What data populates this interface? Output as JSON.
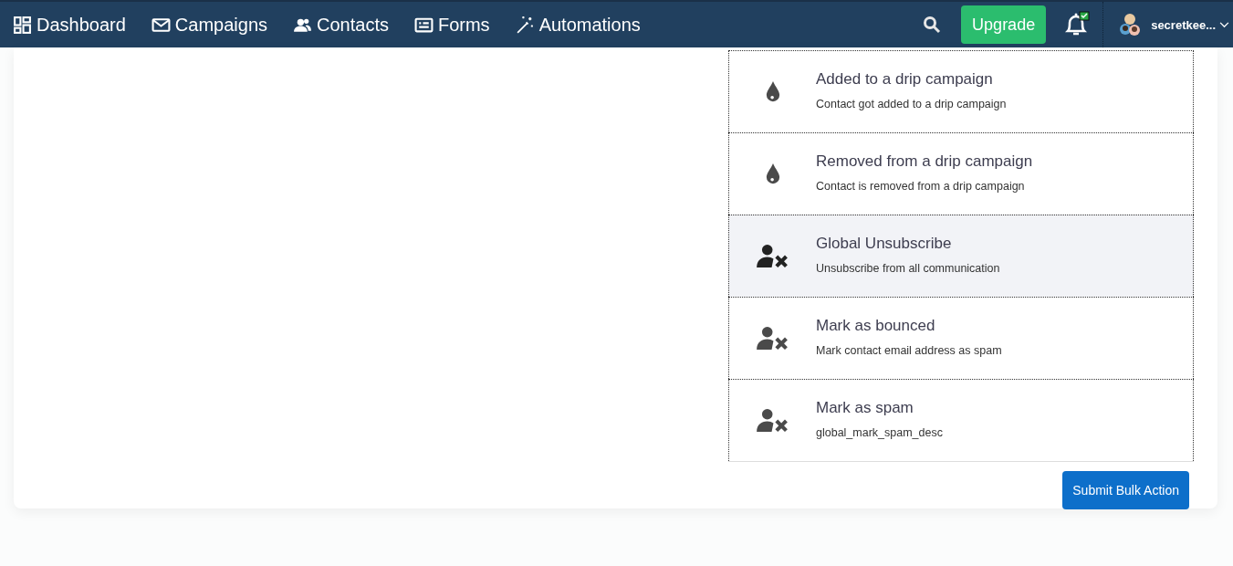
{
  "nav": {
    "items": [
      {
        "label": "Dashboard",
        "kind": "dashboard"
      },
      {
        "label": "Campaigns",
        "kind": "mail"
      },
      {
        "label": "Contacts",
        "kind": "people"
      },
      {
        "label": "Forms",
        "kind": "form"
      },
      {
        "label": "Automations",
        "kind": "wand"
      }
    ],
    "upgrade": "Upgrade",
    "user": "secretkee..."
  },
  "actions": [
    {
      "title": "Added to a drip campaign",
      "description": "Contact got added to a drip campaign",
      "kind": "drip",
      "selected": false
    },
    {
      "title": "Removed from a drip campaign",
      "description": "Contact is removed from a drip campaign",
      "kind": "drip",
      "selected": false
    },
    {
      "title": "Global Unsubscribe",
      "description": "Unsubscribe from all communication",
      "kind": "user-x",
      "selected": true
    },
    {
      "title": "Mark as bounced",
      "description": "Mark contact email address as spam",
      "kind": "user-x",
      "selected": false
    },
    {
      "title": "Mark as spam",
      "description": "global_mark_spam_desc",
      "kind": "user-x",
      "selected": false
    }
  ],
  "submit_button": "Submit Bulk Action"
}
